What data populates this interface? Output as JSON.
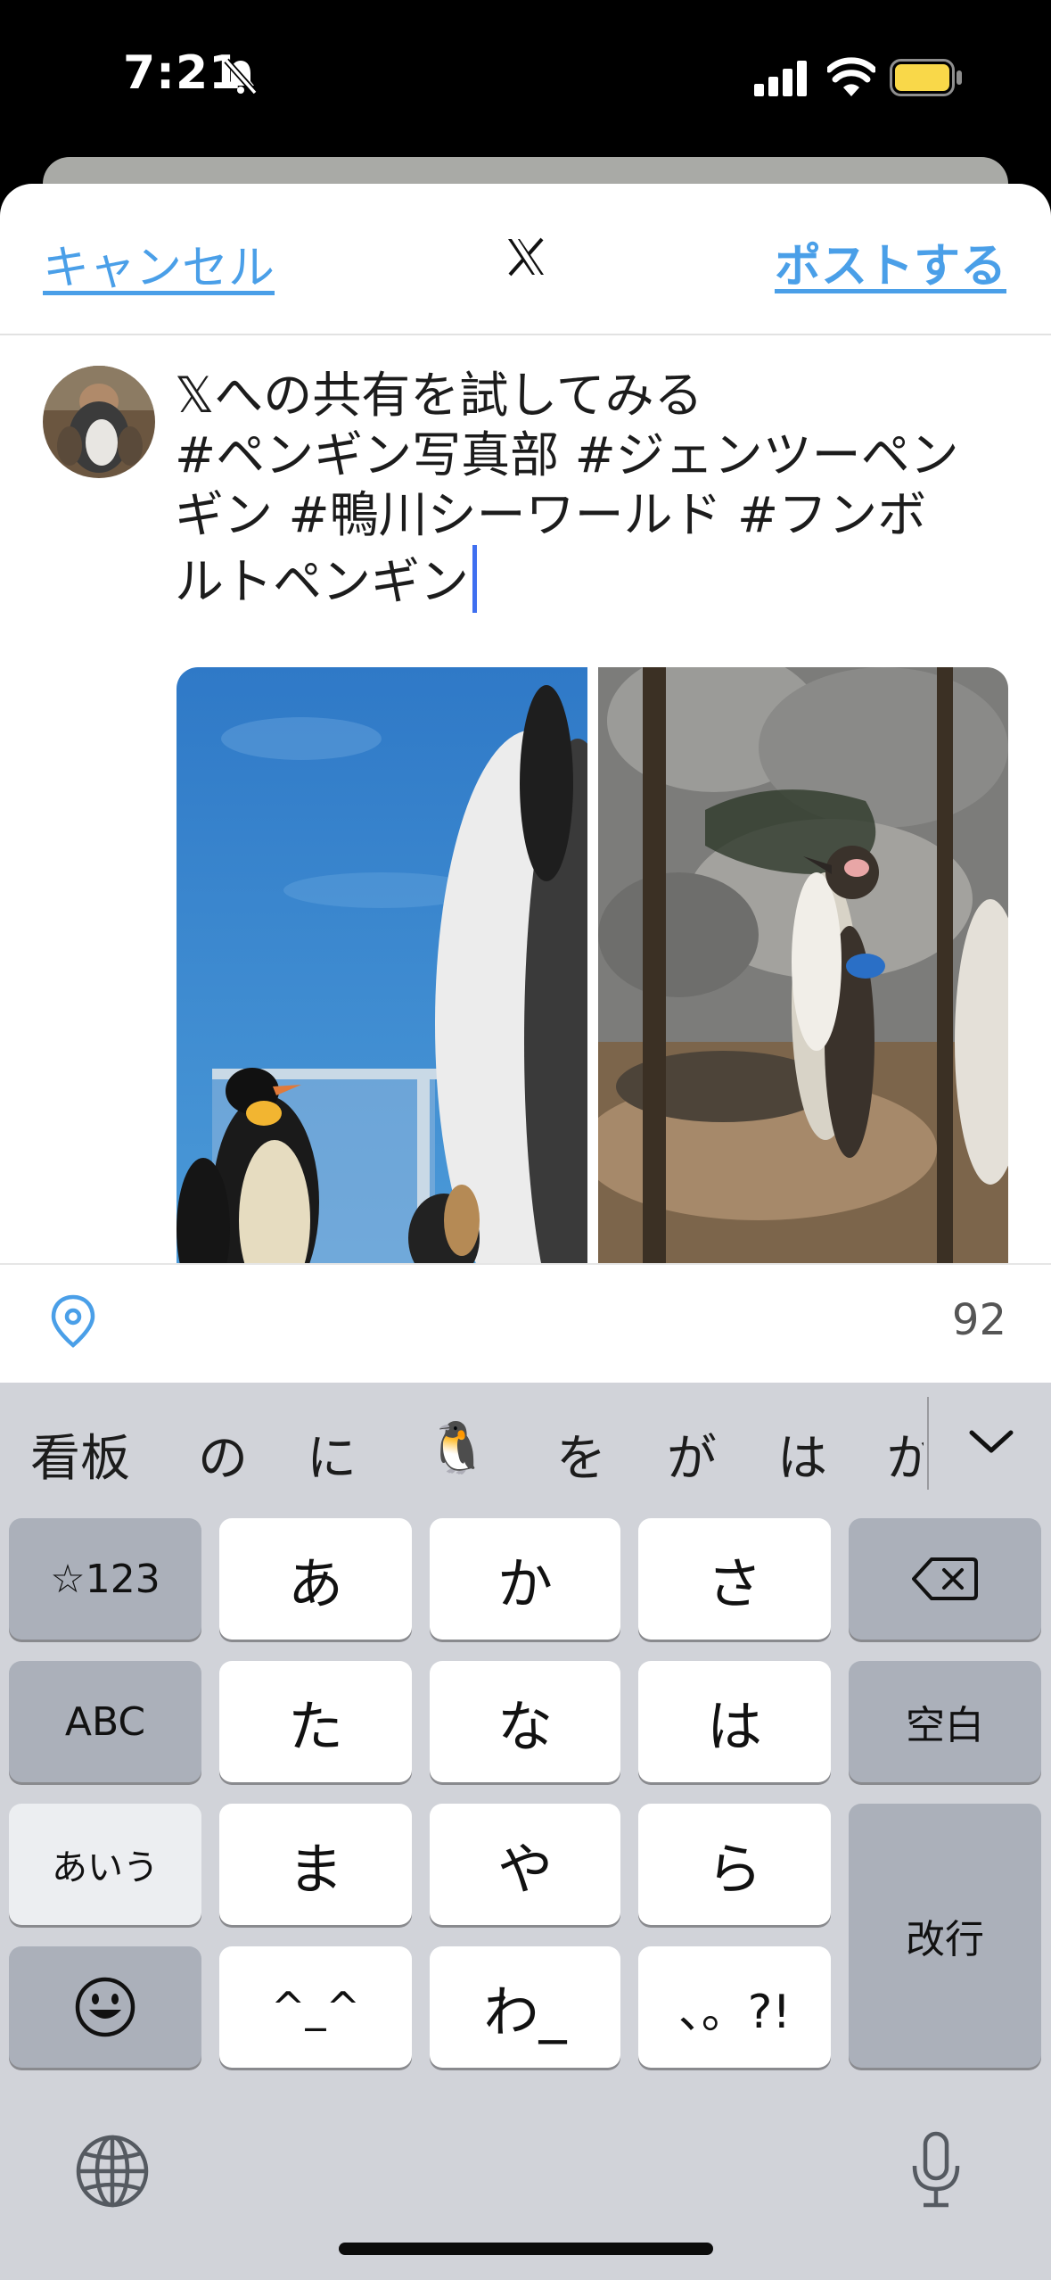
{
  "status_bar": {
    "time": "7:21"
  },
  "compose": {
    "cancel_label": "キャンセル",
    "post_label": "ポストする",
    "tweet_lines": [
      "𝕏への共有を試してみる",
      "#ペンギン写真部 #ジェンツーペン",
      "ギン #鴨川シーワールド #フンボ",
      "ルトペンギン"
    ],
    "char_counter": "92"
  },
  "keyboard": {
    "candidates": [
      "看板",
      "の",
      "に",
      "🐧",
      "を",
      "が",
      "は",
      "か"
    ],
    "keys": {
      "sym": "☆123",
      "abc": "ABC",
      "aiu": "あいう",
      "a": "あ",
      "ka": "か",
      "sa": "さ",
      "ta": "た",
      "na": "な",
      "ha": "は",
      "ma": "ま",
      "ya": "や",
      "ra": "ら",
      "kao": "^_^",
      "wa": "わ_",
      "punct": "、。?!",
      "space": "空白",
      "enter": "改行"
    }
  }
}
